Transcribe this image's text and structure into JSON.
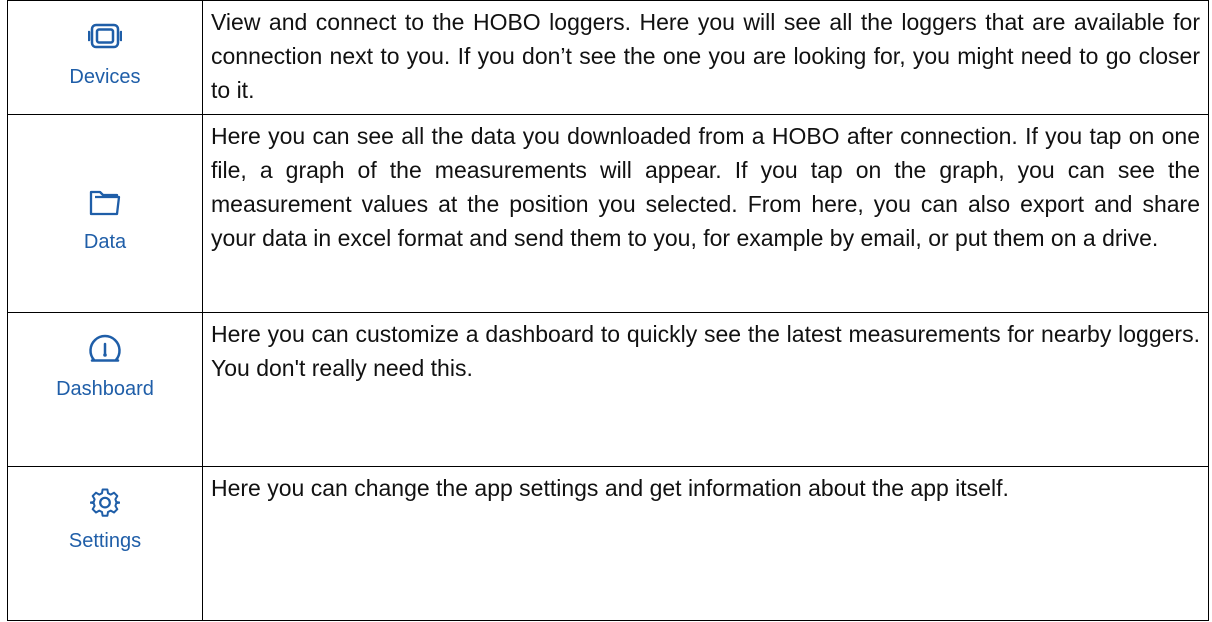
{
  "accent_color": "#1f5ea8",
  "rows": [
    {
      "icon": "device-icon",
      "label": "Devices",
      "description": "View and connect to the HOBO loggers. Here you will see all the loggers that are available for connection next to you. If you don’t see the one you are looking for, you might need to go closer to it."
    },
    {
      "icon": "folder-icon",
      "label": "Data",
      "description": "Here you can see all the data you downloaded from a HOBO after connection. If you tap on one file, a graph of the measurements will appear. If you tap on the graph, you can see the measurement values at the position you selected. From here, you can also export and share your data in excel format and send them to you, for example by email, or put them on a drive."
    },
    {
      "icon": "gauge-icon",
      "label": "Dashboard",
      "description": "Here you can customize a dashboard to quickly see the latest measurements for nearby loggers. You don't really need this."
    },
    {
      "icon": "gear-icon",
      "label": "Settings",
      "description": "Here you can change the app settings and get information about the app itself."
    }
  ]
}
